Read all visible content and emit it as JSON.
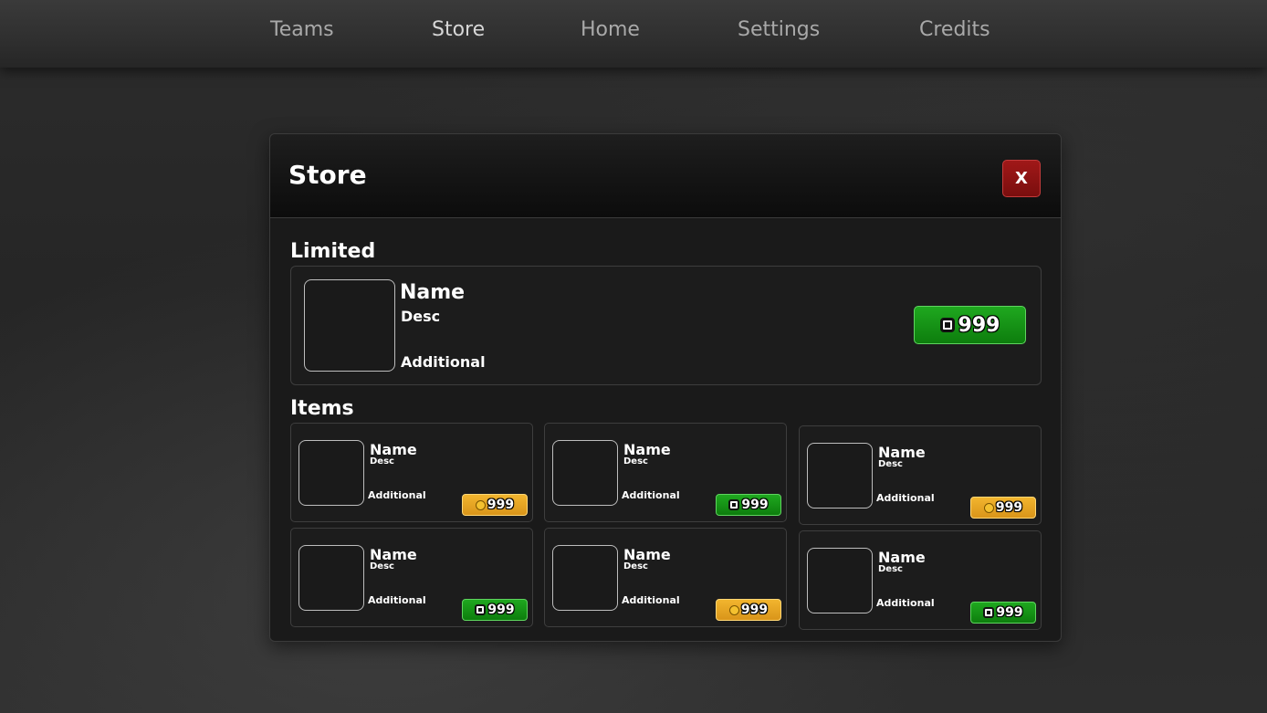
{
  "nav": {
    "items": [
      {
        "label": "Teams"
      },
      {
        "label": "Store"
      },
      {
        "label": "Home"
      },
      {
        "label": "Settings"
      },
      {
        "label": "Credits"
      }
    ]
  },
  "store": {
    "title": "Store",
    "close_label": "X",
    "limited_section": "Limited",
    "items_section": "Items",
    "limited": {
      "name": "Name",
      "desc": "Desc",
      "additional": "Additional",
      "price": "999",
      "currency": "robux-icon",
      "price_color": "#0d8a0d"
    },
    "items": [
      {
        "name": "Name",
        "desc": "Desc",
        "additional": "Additional",
        "price": "999",
        "currency": "coin-icon",
        "price_color": "#e6a322"
      },
      {
        "name": "Name",
        "desc": "Desc",
        "additional": "Additional",
        "price": "999",
        "currency": "robux-icon",
        "price_color": "#0d8a0d"
      },
      {
        "name": "Name",
        "desc": "Desc",
        "additional": "Additional",
        "price": "999",
        "currency": "coin-icon",
        "price_color": "#e6a322"
      },
      {
        "name": "Name",
        "desc": "Desc",
        "additional": "Additional",
        "price": "999",
        "currency": "robux-icon",
        "price_color": "#0d8a0d"
      },
      {
        "name": "Name",
        "desc": "Desc",
        "additional": "Additional",
        "price": "999",
        "currency": "coin-icon",
        "price_color": "#e6a322"
      },
      {
        "name": "Name",
        "desc": "Desc",
        "additional": "Additional",
        "price": "999",
        "currency": "robux-icon",
        "price_color": "#0d8a0d"
      }
    ]
  }
}
